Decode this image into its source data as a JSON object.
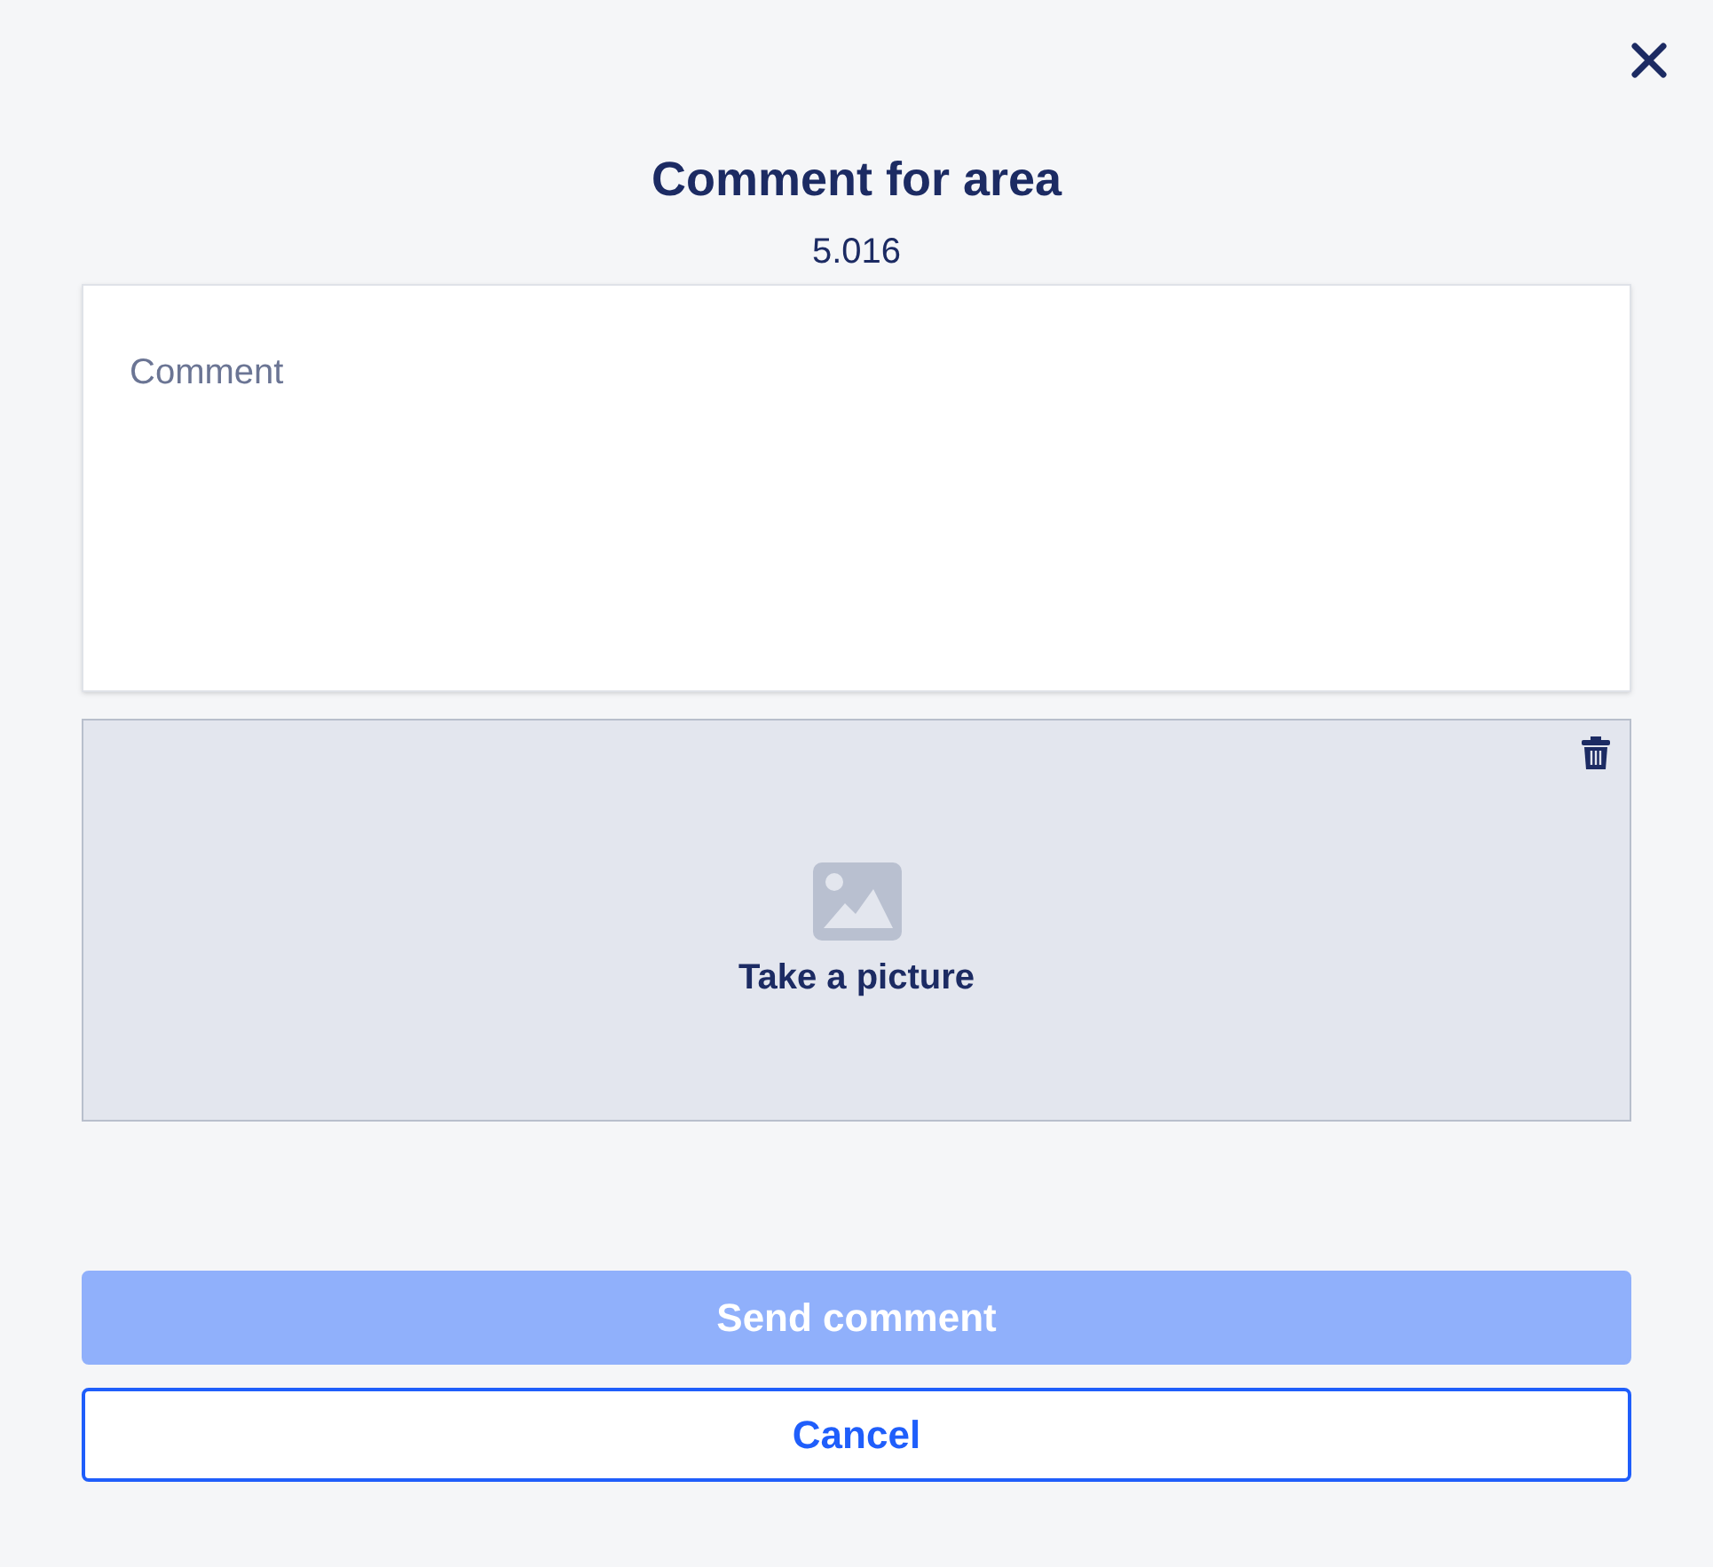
{
  "dialog": {
    "title": "Comment for area",
    "subtitle": "5.016"
  },
  "comment_field": {
    "placeholder": "Comment"
  },
  "photo": {
    "label": "Take a picture"
  },
  "buttons": [
    {
      "kind": "primary",
      "label": "Send comment",
      "disabled": true
    },
    {
      "kind": "secondary",
      "label": "Cancel",
      "disabled": false
    }
  ]
}
